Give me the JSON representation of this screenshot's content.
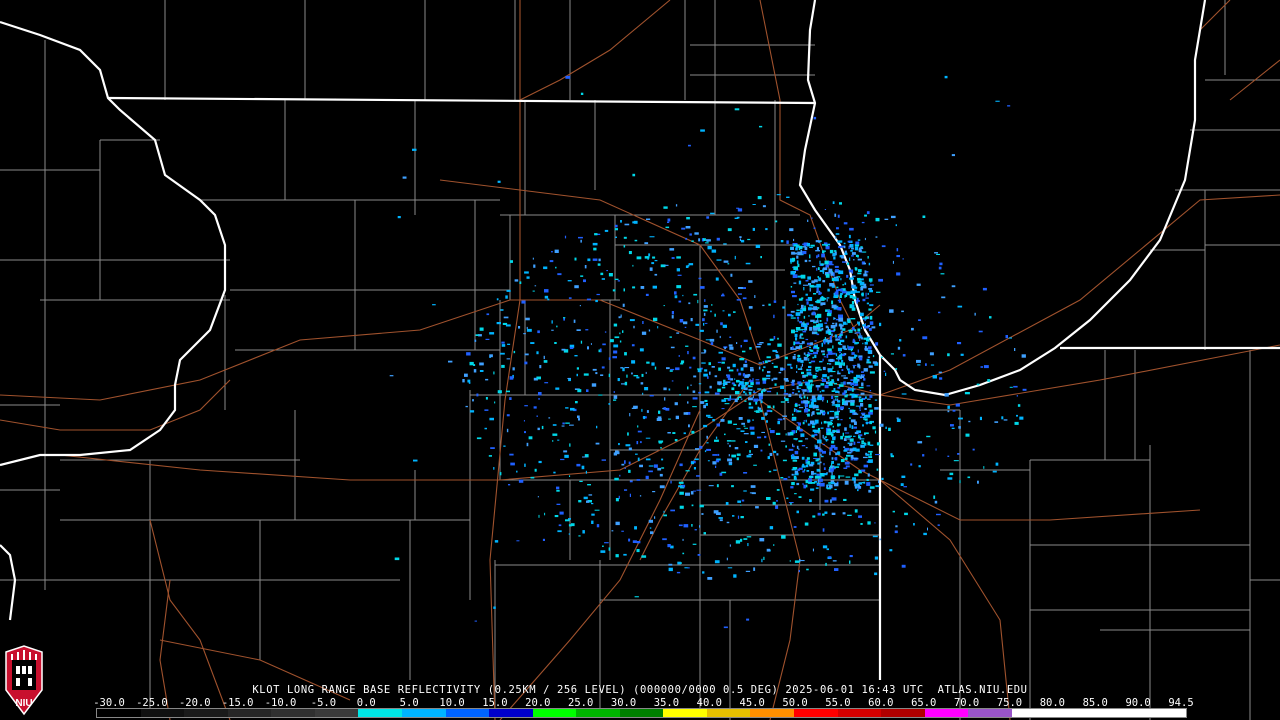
{
  "product": {
    "caption": "KLOT LONG RANGE BASE REFLECTIVITY (0.25KM / 256 LEVEL) (000000/0000 0.5 DEG) 2025-06-01 16:43 UTC  ATLAS.NIU.EDU"
  },
  "colorbar": {
    "ticks": [
      "-30.0",
      "-25.0",
      "-20.0",
      "-15.0",
      "-10.0",
      "-5.0",
      "0.0",
      "5.0",
      "10.0",
      "15.0",
      "20.0",
      "25.0",
      "30.0",
      "35.0",
      "40.0",
      "45.0",
      "50.0",
      "55.0",
      "60.0",
      "65.0",
      "70.0",
      "75.0",
      "80.0",
      "85.0",
      "90.0",
      "94.5"
    ],
    "colors": [
      "#000000",
      "#101010",
      "#1a1a1a",
      "#262626",
      "#303030",
      "#3a3a3a",
      "#00e6e6",
      "#00b4ff",
      "#0064ff",
      "#0000cc",
      "#00ff00",
      "#00b400",
      "#008000",
      "#ffff00",
      "#e6c000",
      "#ff9000",
      "#ff0000",
      "#d40000",
      "#b00000",
      "#ff00ff",
      "#9955c9",
      "#ffffff",
      "#ffffff",
      "#ffffff",
      "#ffffff"
    ]
  },
  "logo": {
    "text": "NIU"
  },
  "colors": {
    "state_border": "#ffffff",
    "county_border": "#8a8a8a",
    "road": "#a0522d",
    "echo_light": "#00b4ff",
    "echo_cyan": "#00d8e8",
    "echo_blue": "#2060ff"
  }
}
